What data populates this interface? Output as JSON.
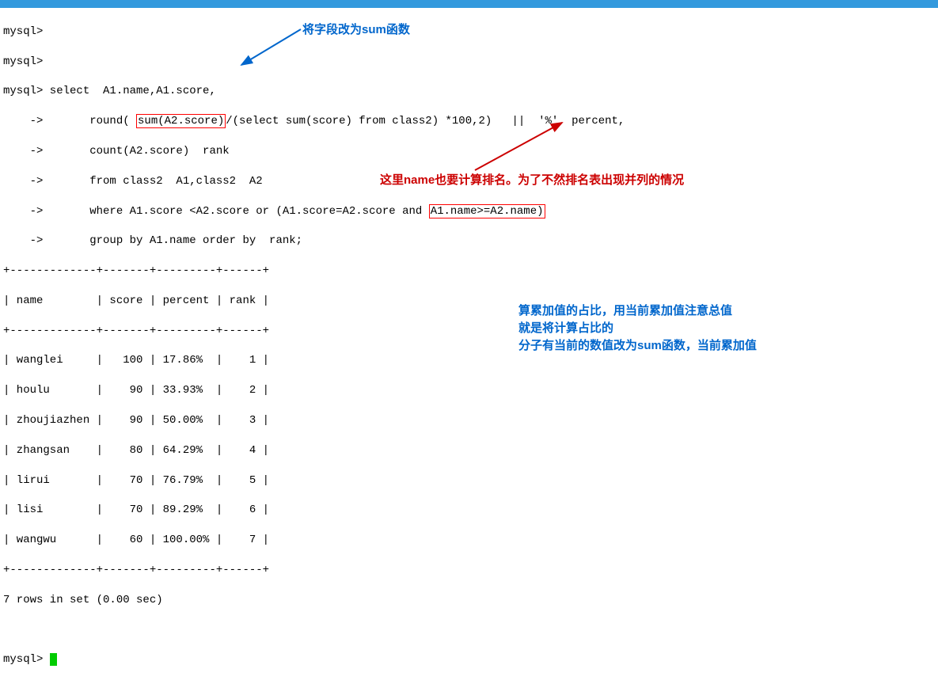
{
  "terminal": {
    "prompts": {
      "mysql": "mysql>",
      "cont": "    ->"
    },
    "lines": {
      "l1": "mysql>",
      "l2": "mysql>",
      "l3_pre": "mysql> select  A1.name,A1.score,",
      "l4_pre": "    ->       round( ",
      "l4_hl": "sum(A2.score)",
      "l4_post": "/(select sum(score) from class2) *100,2)   ||  '%'  percent,",
      "l5": "    ->       count(A2.score)  rank",
      "l6": "    ->       from class2  A1,class2  A2",
      "l7_pre": "    ->       where A1.score <A2.score or (A1.score=A2.score and ",
      "l7_hl": "A1.name>=A2.name)",
      "l8": "    ->       group by A1.name order by  rank;",
      "sep": "+-------------+-------+---------+------+",
      "header": "| name        | score | percent | rank |",
      "rows": [
        "| wanglei     |   100 | 17.86%  |    1 |",
        "| houlu       |    90 | 33.93%  |    2 |",
        "| zhoujiazhen |    90 | 50.00%  |    3 |",
        "| zhangsan    |    80 | 64.29%  |    4 |",
        "| lirui       |    70 | 76.79%  |    5 |",
        "| lisi        |    70 | 89.29%  |    6 |",
        "| wangwu      |    60 | 100.00% |    7 |"
      ],
      "footer": "7 rows in set (0.00 sec)",
      "last_prompt": "mysql> "
    }
  },
  "annotations": {
    "top_blue": "将字段改为sum函数",
    "mid_red": "这里name也要计算排名。为了不然排名表出现并列的情况",
    "bottom_blue_1": "算累加值的占比，用当前累加值注意总值",
    "bottom_blue_2": "就是将计算占比的",
    "bottom_blue_3": "分子有当前的数值改为sum函数，当前累加值"
  },
  "chart_data": {
    "type": "table",
    "title": "MySQL query result",
    "columns": [
      "name",
      "score",
      "percent",
      "rank"
    ],
    "rows": [
      {
        "name": "wanglei",
        "score": 100,
        "percent": "17.86%",
        "rank": 1
      },
      {
        "name": "houlu",
        "score": 90,
        "percent": "33.93%",
        "rank": 2
      },
      {
        "name": "zhoujiazhen",
        "score": 90,
        "percent": "50.00%",
        "rank": 3
      },
      {
        "name": "zhangsan",
        "score": 80,
        "percent": "64.29%",
        "rank": 4
      },
      {
        "name": "lirui",
        "score": 70,
        "percent": "76.79%",
        "rank": 5
      },
      {
        "name": "lisi",
        "score": 70,
        "percent": "89.29%",
        "rank": 6
      },
      {
        "name": "wangwu",
        "score": 60,
        "percent": "100.00%",
        "rank": 7
      }
    ],
    "rows_in_set": 7,
    "elapsed_sec": 0.0
  }
}
